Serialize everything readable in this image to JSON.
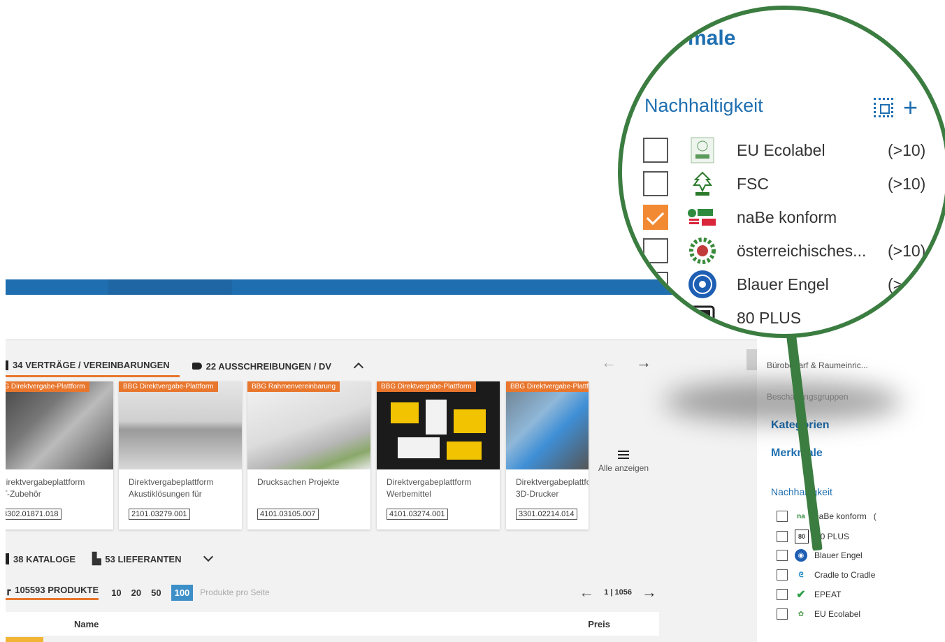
{
  "tabs": {
    "contracts": "34 VERTRÄGE / VEREINBARUNGEN",
    "tenders": "22 AUSSCHREIBUNGEN / DV"
  },
  "cards": [
    {
      "badge": "BBG Direktvergabe-Plattform",
      "title_line1": "Direktvergabeplattform",
      "title_line2": "IT-Zubehör",
      "code": "3302.01871.018"
    },
    {
      "badge": "BBG Direktvergabe-Plattform",
      "title_line1": "Direktvergabeplattform",
      "title_line2": "Akustiklösungen für",
      "code": "2101.03279.001"
    },
    {
      "badge": "BBG Rahmenvereinbarung",
      "title_line1": "Drucksachen Projekte",
      "title_line2": "",
      "code": "4101.03105.007"
    },
    {
      "badge": "BBG Direktvergabe-Plattform",
      "title_line1": "Direktvergabeplattform",
      "title_line2": "Werbemittel",
      "code": "4101.03274.001"
    },
    {
      "badge": "BBG Direktvergabe-Plattform",
      "title_line1": "Direktvergabeplattform",
      "title_line2": "3D-Drucker",
      "code": "3301.02214.014"
    }
  ],
  "show_all": "Alle anzeigen",
  "section2": {
    "catalogs": "38 KATALOGE",
    "suppliers": "53 LIEFERANTEN"
  },
  "products": {
    "count": "105593 PRODUKTE",
    "page_sizes": [
      "10",
      "20",
      "50",
      "100"
    ],
    "per_page_label": "Produkte pro Seite",
    "page_indicator": "1 | 1056"
  },
  "table": {
    "col_name": "Name",
    "col_price": "Preis"
  },
  "sidebar": {
    "breadcrumb": "Bürobedarf & Raumeinric...",
    "procurement_groups": "Beschaffungsgruppen",
    "categories": "Kategorien",
    "features": "Merkmale",
    "sustainability": "Nachhaltigkeit",
    "items": [
      {
        "label": "naBe konform",
        "count": "(",
        "icon": "nabe-icon"
      },
      {
        "label": "80 PLUS",
        "icon": "80plus-icon"
      },
      {
        "label": "Blauer Engel",
        "icon": "blauer-engel-icon"
      },
      {
        "label": "Cradle to Cradle",
        "icon": "cradle-icon"
      },
      {
        "label": "EPEAT",
        "icon": "epeat-icon"
      },
      {
        "label": "EU Ecolabel",
        "icon": "ecolabel-icon"
      }
    ]
  },
  "magnifier": {
    "title": "Merkmale",
    "title_visible": "male",
    "section": "Nachhaltigkeit",
    "items": [
      {
        "label": "EU Ecolabel",
        "count": "(>10)",
        "checked": false
      },
      {
        "label": "FSC",
        "count": "(>10)",
        "checked": false
      },
      {
        "label": "naBe konform",
        "count": "",
        "checked": true
      },
      {
        "label": "österreichisches...",
        "count": "(>10)",
        "checked": false
      },
      {
        "label": "Blauer Engel",
        "count": "(>",
        "checked": false
      },
      {
        "label": "80 PLUS",
        "count": "",
        "checked": false
      }
    ]
  },
  "colors": {
    "brand_blue": "#1f6fb0",
    "accent_orange": "#e8762d",
    "magnifier_green": "#3b7d40"
  }
}
